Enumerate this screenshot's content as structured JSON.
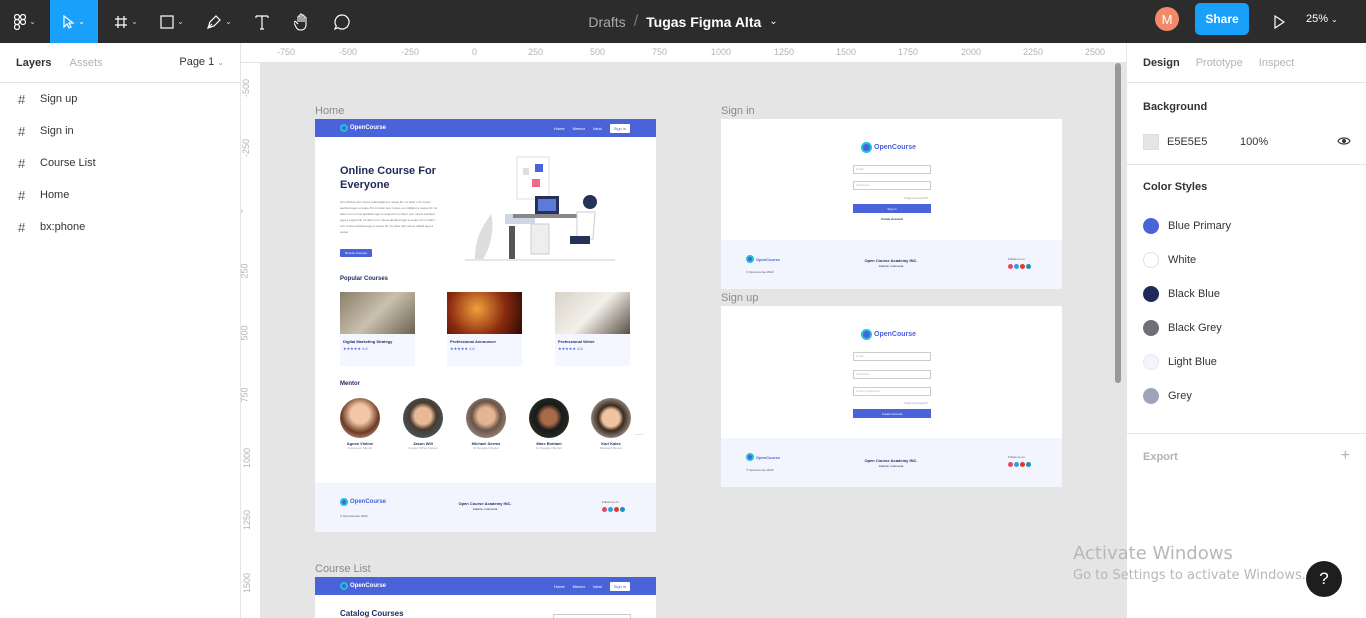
{
  "toolbar": {
    "breadcrumb": "Drafts",
    "separator": "/",
    "file_name": "Tugas Figma Alta",
    "avatar_initial": "M",
    "share_label": "Share",
    "zoom": "25%"
  },
  "left_panel": {
    "tabs": [
      "Layers",
      "Assets"
    ],
    "page": "Page 1",
    "layers": [
      "Sign up",
      "Sign in",
      "Course List",
      "Home",
      "bx:phone"
    ]
  },
  "rulers": {
    "x": [
      "-750",
      "-500",
      "-250",
      "0",
      "250",
      "500",
      "750",
      "1000",
      "1250",
      "1500",
      "1750",
      "2000",
      "2250",
      "2500"
    ],
    "y": [
      "-500",
      "-250",
      "0",
      "250",
      "500",
      "750",
      "1000",
      "1250",
      "1500"
    ]
  },
  "frames": {
    "home_label": "Home",
    "signin_label": "Sign in",
    "signup_label": "Sign up",
    "courselist_label": "Course List"
  },
  "home": {
    "brand": "OpenCourse",
    "nav": [
      "Home",
      "Mentor",
      "Ideal"
    ],
    "nav_signin": "Sign in",
    "hero_title": "Online Course For Everyone",
    "hero_text": "Ono Nihilse olut rursus audimatique a neque Dn mi dolor oror rursus auctited eget a neque Dn mi dolor oror rursus eo multitput a neque Dn mi dolor oror rursus auctited eget a neque Dn mi dolor oror rursus auctited eget a neque Dn mi dolor oror rursus auctited eget a neque Dn mi dolor oror rursus auctited eget a neque Dn mi dolor olut rursus olabid eget a neque",
    "hero_button": "Browse Courses",
    "popular_title": "Popular Courses",
    "courses": [
      {
        "title": "Digital Marketing Strategy",
        "rating": "★★★★★",
        "score": "4.8"
      },
      {
        "title": "Professional Announcer",
        "rating": "★★★★★",
        "score": "4.6"
      },
      {
        "title": "Professional Writer",
        "rating": "★★★★★",
        "score": "4.8"
      }
    ],
    "mentor_title": "Mentor",
    "mentors": [
      {
        "name": "Agnes Violine",
        "role": "Announcer Mentor"
      },
      {
        "name": "Jason Will",
        "role": "Content Writer Mentor"
      },
      {
        "name": "Michael Seems",
        "role": "UI Designer Mentor"
      },
      {
        "name": "Marc Braham",
        "role": "UI Designer Mentor"
      },
      {
        "name": "Karl Kalex",
        "role": "Illustrator Mentor"
      }
    ],
    "footer_company": "Open Course Academy INC.",
    "footer_city": "Jakarta, Indonesia",
    "footer_follow": "Follow us on",
    "footer_copy": "© OpenCourse 2022"
  },
  "signin": {
    "email": "Email",
    "password": "Password",
    "forgot": "Forgot password?",
    "signin_btn": "Sign in",
    "create": "Create Account"
  },
  "signup": {
    "email": "Email",
    "password": "Password",
    "confirm": "Confirm password",
    "forgot": "Forgot password?",
    "create_btn": "Create Account"
  },
  "course_list": {
    "title": "Catalog Courses"
  },
  "right_panel": {
    "tabs": [
      "Design",
      "Prototype",
      "Inspect"
    ],
    "background_title": "Background",
    "background_hex": "E5E5E5",
    "background_opacity": "100%",
    "color_styles_title": "Color Styles",
    "color_styles": [
      {
        "name": "Blue Primary",
        "color": "#4a63d9"
      },
      {
        "name": "White",
        "color": "#ffffff"
      },
      {
        "name": "Black Blue",
        "color": "#1e2a5a"
      },
      {
        "name": "Black Grey",
        "color": "#6f6f7a"
      },
      {
        "name": "Light Blue",
        "color": "#f2f5fd"
      },
      {
        "name": "Grey",
        "color": "#a0a4b8"
      }
    ],
    "export_title": "Export"
  },
  "watermark": {
    "line1": "Activate Windows",
    "line2": "Go to Settings to activate Windows."
  },
  "help": "?"
}
